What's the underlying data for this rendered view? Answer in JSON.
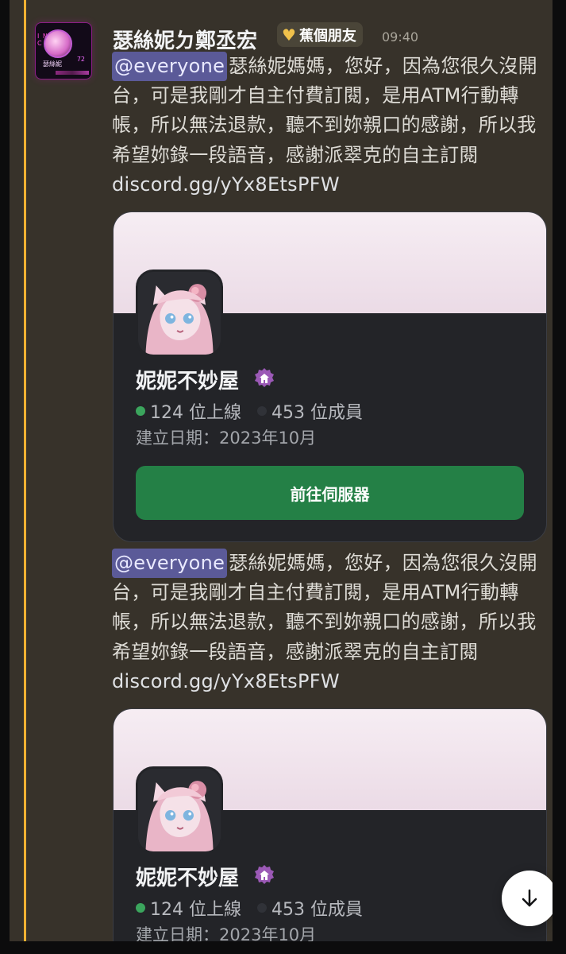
{
  "message": {
    "author": "瑟絲妮ㄉ鄭丞宏",
    "role_tag": "蕉個朋友",
    "time": "09:40",
    "mention": "@everyone",
    "body": "瑟絲妮媽媽，您好，因為您很久沒開台，可是我剛才自主付費訂閱，是用ATM行動轉帳，所以無法退款，聽不到妳親口的感謝，所以我希望妳錄一段語音，感謝派翠克的自主訂閱",
    "invite_link": "discord.gg/yYx8EtsPFW"
  },
  "avatar": {
    "label": "瑟絲妮",
    "badge": "72"
  },
  "invite_card_1": {
    "server_name": "妮妮不妙屋",
    "online_count": "124 位上線",
    "member_count": "453 位成員",
    "created_date": "建立日期：2023年10月",
    "button_label": "前往伺服器"
  },
  "invite_card_2": {
    "server_name": "妮妮不妙屋",
    "online_count": "124 位上線",
    "member_count": "453 位成員",
    "created_date": "建立日期：2023年10月"
  },
  "icons": {
    "avatar": "avatar-icon",
    "role": "heart-icon",
    "verified": "verified-badge-icon",
    "scroll": "arrow-down-icon"
  },
  "colors": {
    "background": "#37322a",
    "mention_bg": "#5b5a98",
    "card_bg": "#232428",
    "button_green": "#248046",
    "online_green": "#3ba55d",
    "accent": "#f0b232"
  }
}
